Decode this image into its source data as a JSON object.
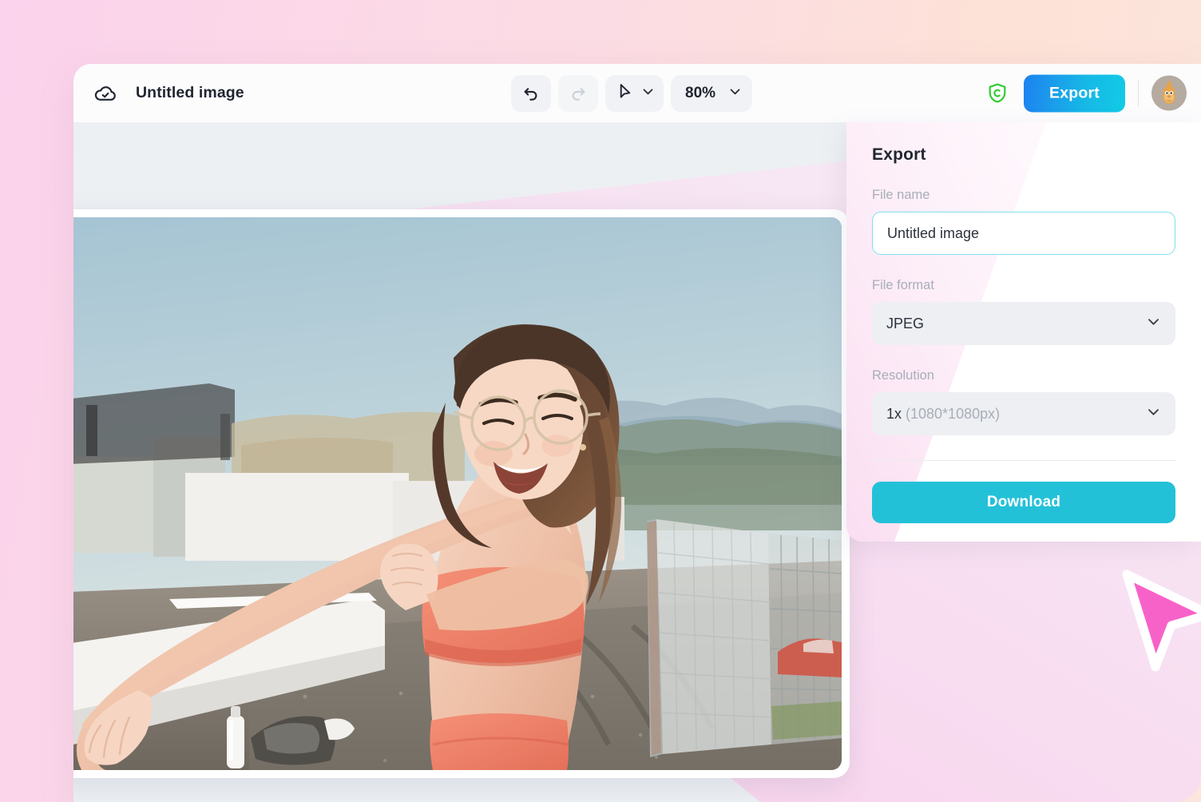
{
  "window": {
    "doc_title": "Untitled image",
    "cloud_icon": "cloud-check-icon"
  },
  "toolbar": {
    "undo_icon": "undo-arrow-icon",
    "redo_icon": "redo-arrow-icon",
    "cursor_icon": "cursor-pointer-icon",
    "cursor_chevron_icon": "chevron-down-icon",
    "zoom_value": "80%",
    "zoom_chevron_icon": "chevron-down-icon"
  },
  "header_right": {
    "shield_icon": "shield-c-icon",
    "export_label": "Export",
    "avatar_icon": "user-avatar-llama"
  },
  "panel": {
    "title": "Export",
    "file_name_label": "File name",
    "file_name_value": "Untitled image",
    "file_name_placeholder": "Untitled image",
    "file_format_label": "File format",
    "file_format_value": "JPEG",
    "file_format_chevron_icon": "chevron-down-icon",
    "resolution_label": "Resolution",
    "resolution_scale": "1x",
    "resolution_dimensions": " (1080*1080px)",
    "resolution_chevron_icon": "chevron-down-icon",
    "download_label": "Download"
  },
  "canvas": {
    "photo_alt": "woman-stretching-on-rooftop",
    "cursor_icon": "pink-pointer-cursor"
  },
  "colors": {
    "background_pink": "#FBD3EC",
    "background_peach": "#FCE5DC",
    "canvas_gray": "#EDF0F3",
    "accent_cyan": "#23C1D8",
    "export_gradient_start": "#1E82F0",
    "export_gradient_end": "#12CBE6",
    "shield_green": "#33CC33",
    "cursor_pink": "#F762C8",
    "input_focus_border": "#7FE0EF",
    "label_gray": "#A8AEB8",
    "text_dark": "#1F2430"
  }
}
